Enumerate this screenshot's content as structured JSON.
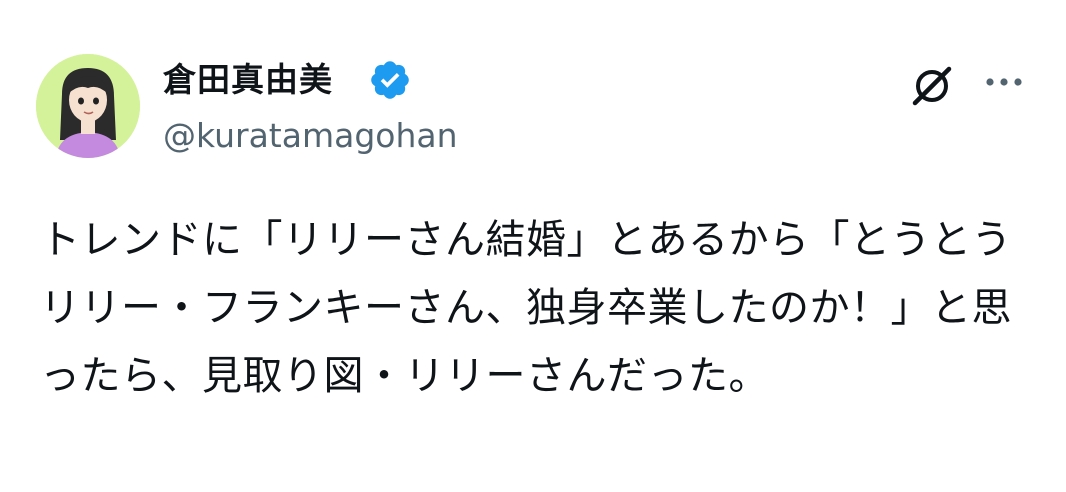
{
  "post": {
    "author": {
      "display_name": "倉田真由美",
      "handle": "@kuratamagohan",
      "verified_icon": "verified-badge-icon",
      "avatar_background": "#d4f29a"
    },
    "actions": {
      "grok_icon": "grok-icon",
      "more_icon": "more-options-icon"
    },
    "text": "トレンドに「リリーさん結婚」とあるから「とうとうリリー・フランキーさん、独身卒業したのか！」と思ったら、見取り図・リリーさんだった。"
  },
  "colors": {
    "verified_blue": "#1d9bf0",
    "text_primary": "#0f1419",
    "text_secondary": "#536471"
  }
}
